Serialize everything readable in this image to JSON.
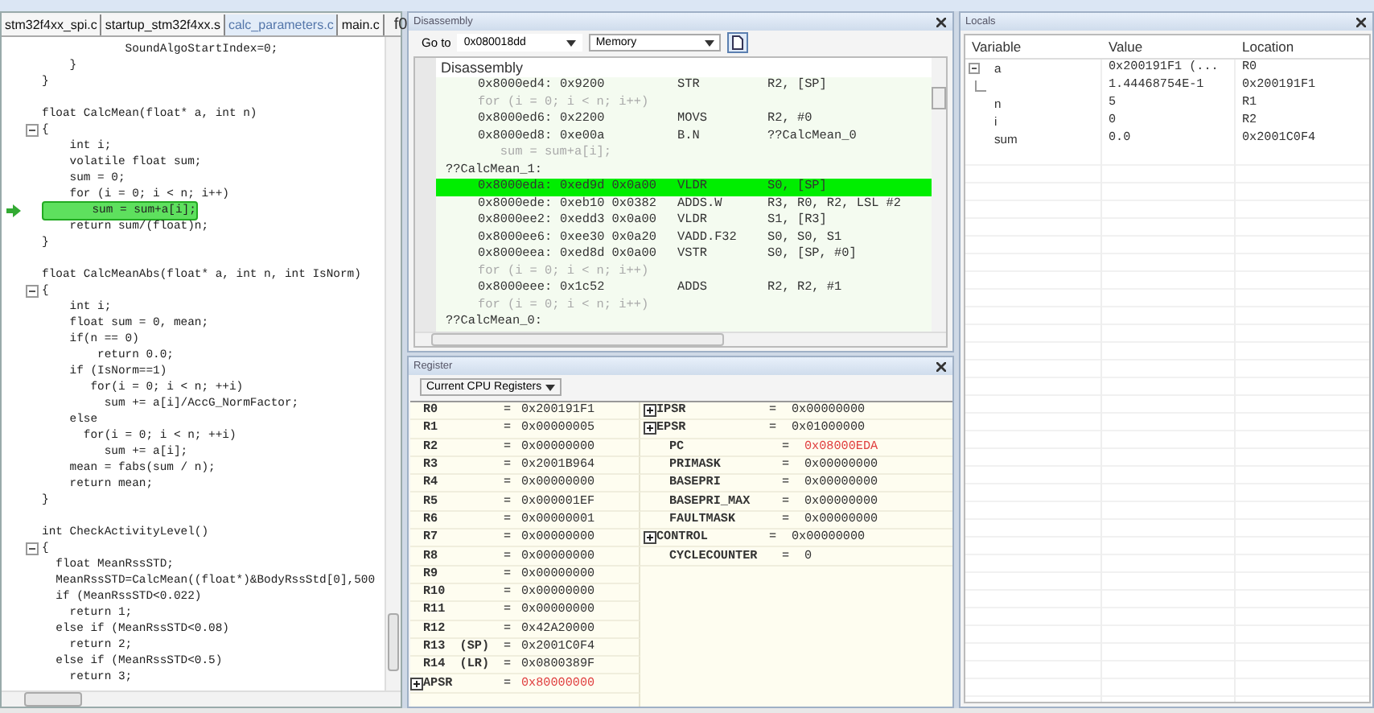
{
  "editor": {
    "tabs": [
      {
        "label": "stm32f4xx_spi.c",
        "selected": false
      },
      {
        "label": "startup_stm32f4xx.s",
        "selected": false
      },
      {
        "label": "calc_parameters.c",
        "selected": true
      },
      {
        "label": "main.c",
        "selected": false
      }
    ],
    "function_selector": "f0",
    "lines": [
      {
        "kind": "code",
        "text": "            SoundAlgoStartIndex=0;",
        "current": false
      },
      {
        "kind": "code",
        "text": "    }",
        "current": false
      },
      {
        "kind": "code",
        "text": "}",
        "current": false
      },
      {
        "kind": "blank"
      },
      {
        "kind": "code",
        "text": "float CalcMean(float* a, int n)",
        "current": false
      },
      {
        "kind": "fold",
        "text": "{",
        "current": false
      },
      {
        "kind": "code",
        "text": "    int i;",
        "current": false
      },
      {
        "kind": "code",
        "text": "    volatile float sum;",
        "current": false
      },
      {
        "kind": "code",
        "text": "    sum = 0;",
        "current": false
      },
      {
        "kind": "code",
        "text": "    for (i = 0; i < n; i++)",
        "current": false
      },
      {
        "kind": "code",
        "text": "       sum = sum+a[i];",
        "current": true
      },
      {
        "kind": "code",
        "text": "    return sum/(float)n;",
        "current": false
      },
      {
        "kind": "code",
        "text": "}",
        "current": false
      },
      {
        "kind": "blank"
      },
      {
        "kind": "code",
        "text": "float CalcMeanAbs(float* a, int n, int IsNorm)",
        "current": false
      },
      {
        "kind": "fold",
        "text": "{",
        "current": false
      },
      {
        "kind": "code",
        "text": "    int i;",
        "current": false
      },
      {
        "kind": "code",
        "text": "    float sum = 0, mean;",
        "current": false
      },
      {
        "kind": "code",
        "text": "    if(n == 0)",
        "current": false
      },
      {
        "kind": "code",
        "text": "        return 0.0;",
        "current": false
      },
      {
        "kind": "code",
        "text": "    if (IsNorm==1)",
        "current": false
      },
      {
        "kind": "code",
        "text": "       for(i = 0; i < n; ++i)",
        "current": false
      },
      {
        "kind": "code",
        "text": "         sum += a[i]/AccG_NormFactor;",
        "current": false
      },
      {
        "kind": "code",
        "text": "    else",
        "current": false
      },
      {
        "kind": "code",
        "text": "      for(i = 0; i < n; ++i)",
        "current": false
      },
      {
        "kind": "code",
        "text": "         sum += a[i];",
        "current": false
      },
      {
        "kind": "code",
        "text": "    mean = fabs(sum / n);",
        "current": false
      },
      {
        "kind": "code",
        "text": "    return mean;",
        "current": false
      },
      {
        "kind": "code",
        "text": "}",
        "current": false
      },
      {
        "kind": "blank"
      },
      {
        "kind": "code",
        "text": "int CheckActivityLevel()",
        "current": false
      },
      {
        "kind": "fold",
        "text": "{",
        "current": false
      },
      {
        "kind": "code",
        "text": "  float MeanRssSTD;",
        "current": false
      },
      {
        "kind": "code",
        "text": "  MeanRssSTD=CalcMean((float*)&BodyRssStd[0],500",
        "current": false
      },
      {
        "kind": "code",
        "text": "  if (MeanRssSTD<0.022)",
        "current": false
      },
      {
        "kind": "code",
        "text": "    return 1;",
        "current": false
      },
      {
        "kind": "code",
        "text": "  else if (MeanRssSTD<0.08)",
        "current": false
      },
      {
        "kind": "code",
        "text": "    return 2;",
        "current": false
      },
      {
        "kind": "code",
        "text": "  else if (MeanRssSTD<0.5)",
        "current": false
      },
      {
        "kind": "code",
        "text": "    return 3;",
        "current": false
      }
    ]
  },
  "disassembly": {
    "title": "Disassembly",
    "goto_label": "Go to",
    "address": "0x080018dd",
    "view": "Memory",
    "heading": "Disassembly",
    "rows": [
      {
        "kind": "instr",
        "address": "0x8000ed4:",
        "opcode": "0x9200",
        "mnemonic": "STR",
        "operands": "R2, [SP]",
        "current": false
      },
      {
        "kind": "source",
        "text": "for (i = 0; i < n; i++)"
      },
      {
        "kind": "instr",
        "address": "0x8000ed6:",
        "opcode": "0x2200",
        "mnemonic": "MOVS",
        "operands": "R2, #0",
        "current": false
      },
      {
        "kind": "instr",
        "address": "0x8000ed8:",
        "opcode": "0xe00a",
        "mnemonic": "B.N",
        "operands": "??CalcMean_0",
        "current": false
      },
      {
        "kind": "source",
        "text": "   sum = sum+a[i];"
      },
      {
        "kind": "label",
        "text": "??CalcMean_1:"
      },
      {
        "kind": "instr",
        "address": "0x8000eda:",
        "opcode": "0xed9d 0x0a00",
        "mnemonic": "VLDR",
        "operands": "S0, [SP]",
        "current": true
      },
      {
        "kind": "instr",
        "address": "0x8000ede:",
        "opcode": "0xeb10 0x0382",
        "mnemonic": "ADDS.W",
        "operands": "R3, R0, R2, LSL #2",
        "current": false
      },
      {
        "kind": "instr",
        "address": "0x8000ee2:",
        "opcode": "0xedd3 0x0a00",
        "mnemonic": "VLDR",
        "operands": "S1, [R3]",
        "current": false
      },
      {
        "kind": "instr",
        "address": "0x8000ee6:",
        "opcode": "0xee30 0x0a20",
        "mnemonic": "VADD.F32",
        "operands": "S0, S0, S1",
        "current": false
      },
      {
        "kind": "instr",
        "address": "0x8000eea:",
        "opcode": "0xed8d 0x0a00",
        "mnemonic": "VSTR",
        "operands": "S0, [SP, #0]",
        "current": false
      },
      {
        "kind": "source",
        "text": "for (i = 0; i < n; i++)"
      },
      {
        "kind": "instr",
        "address": "0x8000eee:",
        "opcode": "0x1c52",
        "mnemonic": "ADDS",
        "operands": "R2, R2, #1",
        "current": false
      },
      {
        "kind": "source",
        "text": "for (i = 0; i < n; i++)"
      },
      {
        "kind": "label",
        "text": "??CalcMean_0:"
      }
    ]
  },
  "register": {
    "title": "Register",
    "view": "Current CPU Registers",
    "left": [
      {
        "name": "R0",
        "eq": "=",
        "value": "0x200191F1",
        "expandable": false,
        "changed": false
      },
      {
        "name": "R1",
        "eq": "=",
        "value": "0x00000005",
        "expandable": false,
        "changed": false
      },
      {
        "name": "R2",
        "eq": "=",
        "value": "0x00000000",
        "expandable": false,
        "changed": false
      },
      {
        "name": "R3",
        "eq": "=",
        "value": "0x2001B964",
        "expandable": false,
        "changed": false
      },
      {
        "name": "R4",
        "eq": "=",
        "value": "0x00000000",
        "expandable": false,
        "changed": false
      },
      {
        "name": "R5",
        "eq": "=",
        "value": "0x000001EF",
        "expandable": false,
        "changed": false
      },
      {
        "name": "R6",
        "eq": "=",
        "value": "0x00000001",
        "expandable": false,
        "changed": false
      },
      {
        "name": "R7",
        "eq": "=",
        "value": "0x00000000",
        "expandable": false,
        "changed": false
      },
      {
        "name": "R8",
        "eq": "=",
        "value": "0x00000000",
        "expandable": false,
        "changed": false
      },
      {
        "name": "R9",
        "eq": "=",
        "value": "0x00000000",
        "expandable": false,
        "changed": false
      },
      {
        "name": "R10",
        "eq": "=",
        "value": "0x00000000",
        "expandable": false,
        "changed": false
      },
      {
        "name": "R11",
        "eq": "=",
        "value": "0x00000000",
        "expandable": false,
        "changed": false
      },
      {
        "name": "R12",
        "eq": "=",
        "value": "0x42A20000",
        "expandable": false,
        "changed": false
      },
      {
        "name": "R13  (SP)",
        "eq": "=",
        "value": "0x2001C0F4",
        "expandable": false,
        "changed": false
      },
      {
        "name": "R14  (LR)",
        "eq": "=",
        "value": "0x0800389F",
        "expandable": false,
        "changed": false
      },
      {
        "name": "APSR",
        "eq": "=",
        "value": "0x80000000",
        "expandable": true,
        "changed": true
      }
    ],
    "right": [
      {
        "name": "IPSR",
        "eq": "=",
        "value": "0x00000000",
        "expandable": true,
        "changed": false
      },
      {
        "name": "EPSR",
        "eq": "=",
        "value": "0x01000000",
        "expandable": true,
        "changed": false
      },
      {
        "name": "PC",
        "eq": "=",
        "value": "0x08000EDA",
        "expandable": false,
        "changed": true
      },
      {
        "name": "PRIMASK",
        "eq": "=",
        "value": "0x00000000",
        "expandable": false,
        "changed": false
      },
      {
        "name": "BASEPRI",
        "eq": "=",
        "value": "0x00000000",
        "expandable": false,
        "changed": false
      },
      {
        "name": "BASEPRI_MAX",
        "eq": "=",
        "value": "0x00000000",
        "expandable": false,
        "changed": false
      },
      {
        "name": "FAULTMASK",
        "eq": "=",
        "value": "0x00000000",
        "expandable": false,
        "changed": false
      },
      {
        "name": "CONTROL",
        "eq": "=",
        "value": "0x00000000",
        "expandable": true,
        "changed": false
      },
      {
        "name": "CYCLECOUNTER",
        "eq": "=",
        "value": "0",
        "expandable": false,
        "changed": false
      }
    ]
  },
  "locals": {
    "title": "Locals",
    "columns": [
      "Variable",
      "Value",
      "Location"
    ],
    "rows": [
      {
        "name": "a",
        "value": "0x200191F1 (...",
        "location": "R0",
        "expanded": true,
        "children": [
          {
            "value": "1.44468754E-1",
            "location": "0x200191F1"
          }
        ]
      },
      {
        "name": "n",
        "value": "5",
        "location": "R1"
      },
      {
        "name": "i",
        "value": "0",
        "location": "R2"
      },
      {
        "name": "sum",
        "value": "0.0",
        "location": "0x2001C0F4"
      }
    ]
  }
}
